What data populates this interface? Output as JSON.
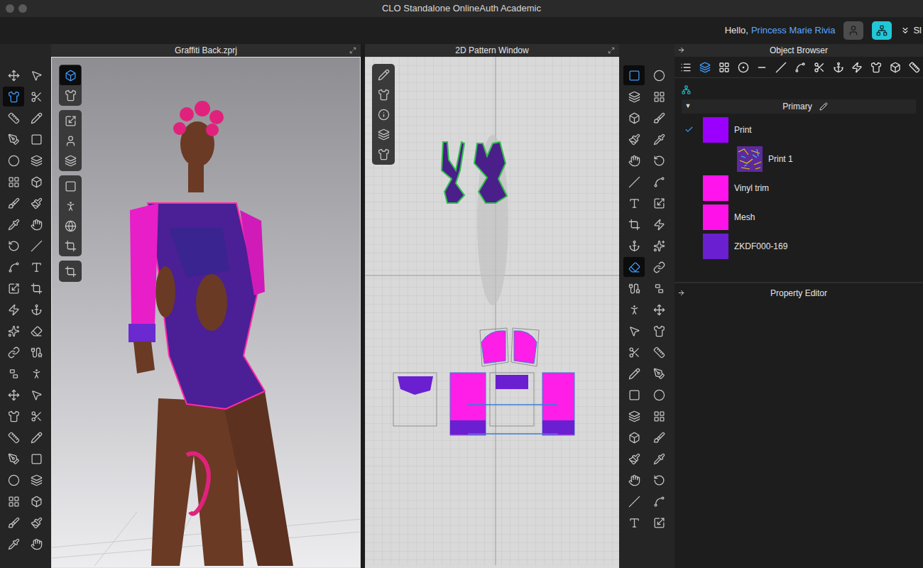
{
  "window": {
    "title": "CLO Standalone OnlineAuth Academic"
  },
  "top_bar": {
    "greeting": "Hello,",
    "user": "Princess Marie Rivia",
    "menu_label": "Sl"
  },
  "left_toolbar": {
    "tools": [
      {
        "selected": false
      },
      {
        "selected": false
      },
      {
        "selected": true
      },
      {
        "selected": false
      },
      {
        "selected": false
      },
      {
        "selected": false
      },
      {
        "selected": false
      },
      {
        "selected": false
      },
      {
        "selected": false
      },
      {
        "selected": false
      },
      {
        "selected": false
      },
      {
        "selected": false
      },
      {
        "selected": false
      },
      {
        "selected": false
      },
      {
        "selected": false
      },
      {
        "selected": false
      },
      {
        "selected": false
      },
      {
        "selected": false
      },
      {
        "selected": false
      },
      {
        "selected": false
      },
      {
        "selected": false
      },
      {
        "selected": false
      },
      {
        "selected": false
      },
      {
        "selected": false
      },
      {
        "selected": false
      },
      {
        "selected": false
      },
      {
        "selected": false
      },
      {
        "selected": false
      },
      {
        "selected": false
      },
      {
        "selected": false
      },
      {
        "selected": false
      },
      {
        "selected": false
      },
      {
        "selected": false
      },
      {
        "selected": false
      },
      {
        "selected": false
      },
      {
        "selected": false
      },
      {
        "selected": false
      },
      {
        "selected": false
      },
      {
        "selected": false
      },
      {
        "selected": false
      },
      {
        "selected": false
      },
      {
        "selected": false
      },
      {
        "selected": false
      },
      {
        "selected": false
      },
      {
        "selected": false
      },
      {
        "selected": false
      }
    ]
  },
  "viewport": {
    "title": "Graffiti Back.zprj",
    "tool_groups": [
      [
        {
          "selected": true
        },
        {
          "selected": false
        }
      ],
      [
        {
          "selected": false
        },
        {
          "selected": false
        },
        {
          "selected": false
        }
      ],
      [
        {
          "selected": false
        },
        {
          "selected": false
        },
        {
          "selected": false
        },
        {
          "selected": false
        }
      ],
      [
        {
          "selected": false
        }
      ]
    ]
  },
  "pattern_window": {
    "title": "2D Pattern Window",
    "tools": [
      {
        "selected": false
      },
      {
        "selected": false
      },
      {
        "selected": false
      },
      {
        "selected": false
      },
      {
        "selected": false
      }
    ]
  },
  "right_toolbar": {
    "tools": [
      {
        "selected": true
      },
      {
        "selected": false
      },
      {
        "selected": false
      },
      {
        "selected": false
      },
      {
        "selected": false
      },
      {
        "selected": false
      },
      {
        "selected": false
      },
      {
        "selected": false
      },
      {
        "selected": false
      },
      {
        "selected": false
      },
      {
        "selected": false
      },
      {
        "selected": false
      },
      {
        "selected": false
      },
      {
        "selected": false
      },
      {
        "selected": false
      },
      {
        "selected": false
      },
      {
        "selected": false
      },
      {
        "selected": false
      },
      {
        "selected": true
      },
      {
        "selected": false
      },
      {
        "selected": false
      },
      {
        "selected": false
      },
      {
        "selected": false
      },
      {
        "selected": false
      },
      {
        "selected": false
      },
      {
        "selected": false
      },
      {
        "selected": false
      },
      {
        "selected": false
      },
      {
        "selected": false
      },
      {
        "selected": false
      },
      {
        "selected": false
      },
      {
        "selected": false
      },
      {
        "selected": false
      },
      {
        "selected": false
      },
      {
        "selected": false
      },
      {
        "selected": false
      },
      {
        "selected": false
      },
      {
        "selected": false
      },
      {
        "selected": false
      },
      {
        "selected": false
      },
      {
        "selected": false
      },
      {
        "selected": false
      },
      {
        "selected": false
      },
      {
        "selected": false
      }
    ]
  },
  "object_browser": {
    "title": "Object Browser",
    "tabs": [
      {
        "selected": false
      },
      {
        "selected": true
      },
      {
        "selected": false
      },
      {
        "selected": false
      },
      {
        "selected": false
      },
      {
        "selected": false
      },
      {
        "selected": false
      },
      {
        "selected": false
      },
      {
        "selected": false
      },
      {
        "selected": false
      },
      {
        "selected": false
      },
      {
        "selected": false
      },
      {
        "selected": false
      }
    ],
    "colorway": {
      "name": "Primary",
      "toggle": "▼",
      "expanded": true
    },
    "fabrics": [
      {
        "name": "Print",
        "color": "#9b00ff",
        "checked": true,
        "kind": "fabric"
      },
      {
        "name": "Print 1",
        "color": "#5b2a9c",
        "checked": false,
        "kind": "texture"
      },
      {
        "name": "Vinyl trim",
        "color": "#ff14ee",
        "checked": false,
        "kind": "fabric"
      },
      {
        "name": "Mesh",
        "color": "#ff12ea",
        "checked": false,
        "kind": "fabric"
      },
      {
        "name": "ZKDF000-169",
        "color": "#6a1fd0",
        "checked": false,
        "kind": "fabric"
      }
    ]
  },
  "property_editor": {
    "title": "Property Editor"
  }
}
